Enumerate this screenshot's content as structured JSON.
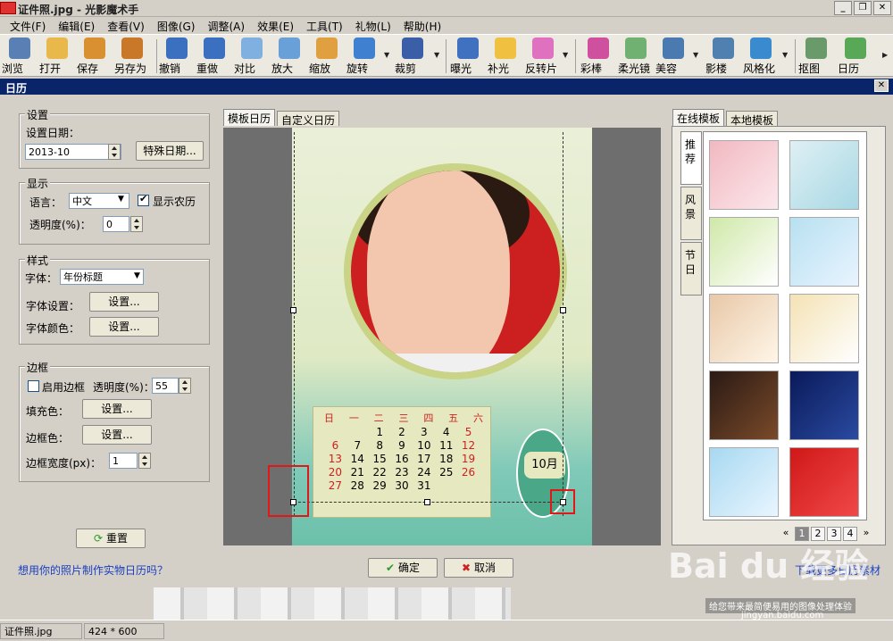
{
  "window": {
    "title": "证件照.jpg - 光影魔术手"
  },
  "menu": [
    "文件(F)",
    "编辑(E)",
    "查看(V)",
    "图像(G)",
    "调整(A)",
    "效果(E)",
    "工具(T)",
    "礼物(L)",
    "帮助(H)"
  ],
  "toolbar": {
    "browse": "浏览",
    "open": "打开",
    "save": "保存",
    "save_as": "另存为",
    "undo": "撤销",
    "redo": "重做",
    "compare": "对比",
    "zoom_in": "放大",
    "zoom_out": "缩放",
    "rotate": "旋转",
    "crop": "裁剪",
    "exposure": "曝光",
    "fill_light": "补光",
    "invert": "反转片",
    "color_wand": "彩棒",
    "soft_light": "柔光镜",
    "beauty": "美容",
    "shadow": "影楼",
    "stylize": "风格化",
    "cutout": "抠图",
    "calendar": "日历"
  },
  "dialog": {
    "title": "日历",
    "settings": {
      "group": "设置",
      "date_label": "设置日期：",
      "date_value": "2013-10",
      "special_date_button": "特殊日期..."
    },
    "display": {
      "group": "显示",
      "language_label": "语言：",
      "language_value": "中文",
      "show_lunar": "显示农历",
      "opacity_label": "透明度(%)：",
      "opacity_value": "0"
    },
    "style": {
      "group": "样式",
      "font_label": "字体：",
      "font_value": "年份标题",
      "font_settings_label": "字体设置：",
      "font_settings_button": "设置...",
      "font_color_label": "字体颜色：",
      "font_color_button": "设置..."
    },
    "border": {
      "group": "边框",
      "enable_border": "启用边框",
      "opacity_label": "透明度(%)：",
      "opacity_value": "55",
      "fill_label": "填充色：",
      "fill_button": "设置...",
      "border_color_label": "边框色：",
      "border_color_button": "设置...",
      "width_label": "边框宽度(px)：",
      "width_value": "1"
    },
    "reset_button": "重置",
    "promo_link": "想用你的照片制作实物日历吗？",
    "tabs": {
      "template": "模板日历",
      "custom": "自定义日历"
    },
    "calendar": {
      "weekdays": [
        "日",
        "一",
        "二",
        "三",
        "四",
        "五",
        "六"
      ],
      "days": [
        "",
        "",
        "1",
        "2",
        "3",
        "4",
        "5",
        "6",
        "7",
        "8",
        "9",
        "10",
        "11",
        "12",
        "13",
        "14",
        "15",
        "16",
        "17",
        "18",
        "19",
        "20",
        "21",
        "22",
        "23",
        "24",
        "25",
        "26",
        "27",
        "28",
        "29",
        "30",
        "31",
        "",
        ""
      ],
      "month_label": "10月"
    },
    "right_tabs": {
      "online": "在线模板",
      "local": "本地模板"
    },
    "side_tabs": [
      "推荐",
      "风景",
      "节日"
    ],
    "pager": [
      "«",
      "1",
      "2",
      "3",
      "4",
      "»"
    ],
    "ok_button": "确定",
    "cancel_button": "取消",
    "download_link": "下载更多日历素材"
  },
  "status": {
    "file": "证件照.jpg",
    "size": "424 * 600"
  },
  "watermark": {
    "brand": "Bai du 经验",
    "slogan": "给您带来最简便易用的图像处理体验",
    "url": "jingyan.baidu.com"
  }
}
